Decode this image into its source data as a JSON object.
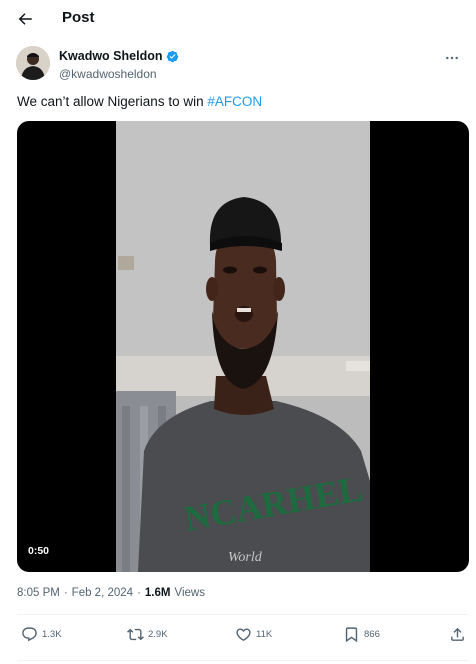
{
  "header": {
    "title": "Post"
  },
  "author": {
    "name": "Kwadwo Sheldon",
    "handle": "@kwadwosheldon"
  },
  "tweet": {
    "text": "We can’t allow Nigerians to win ",
    "hashtag": "#AFCON"
  },
  "media": {
    "duration": "0:50",
    "shirt_text": "NCARHEL",
    "shirt_subtext": "World"
  },
  "meta": {
    "time": "8:05 PM",
    "separator1": "·",
    "date": "Feb 2, 2024",
    "separator2": "·",
    "views_count": "1.6M",
    "views_label": "Views"
  },
  "actions": {
    "replies": "1.3K",
    "reposts": "2.9K",
    "likes": "11K",
    "bookmarks": "866"
  },
  "colors": {
    "accent": "#1d9bf0",
    "secondary_text": "#536471"
  },
  "icons": [
    "back-arrow-icon",
    "verified-badge-icon",
    "more-icon",
    "reply-icon",
    "repost-icon",
    "like-icon",
    "bookmark-icon",
    "share-icon"
  ]
}
